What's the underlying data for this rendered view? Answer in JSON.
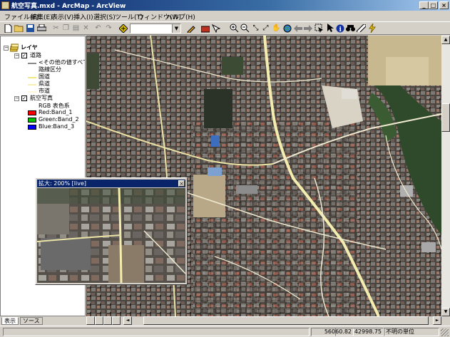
{
  "window": {
    "title": "航空写真.mxd - ArcMap - ArcView",
    "minimize_glyph": "_",
    "maximize_glyph": "□",
    "close_glyph": "×"
  },
  "menu": [
    "ファイル(F)",
    "編集(E)",
    "表示(V)",
    "挿入(I)",
    "選択(S)",
    "ツール(T)",
    "ウィンドウ(W)",
    "ヘルプ(H)"
  ],
  "toolbar": {
    "scale_value": "",
    "layer_value": "|0"
  },
  "toc": {
    "root_label": "レイヤ",
    "roads_layer": "道路",
    "roads_default_symbol": "<その他の値すべて>",
    "roads_field": "路線区分",
    "road_classes": [
      "国道",
      "県道",
      "市道"
    ],
    "photo_layer": "航空写真",
    "photo_renderer": "RGB 表色系",
    "bands": [
      "Red:Band_1",
      "Green:Band_2",
      "Blue:Band_3"
    ],
    "band_colors": [
      "#ff0000",
      "#00c000",
      "#0000ff"
    ],
    "road_class_colors": [
      "#f0e880",
      "#f8f0b0",
      "#fff8d8"
    ],
    "check_glyph": "✓",
    "collapse_glyph": "−"
  },
  "tabs": [
    "表示",
    "ソース"
  ],
  "magnifier": {
    "title": "拡大: 200% [live]",
    "close_glyph": "×"
  },
  "status": {
    "x": "56060.82",
    "y": "42998.75",
    "units": "不明の単位"
  },
  "scroll_glyphs": {
    "up": "▲",
    "down": "▼",
    "left": "◄",
    "right": "►"
  },
  "colors": {
    "titlebar": "#0a246a",
    "map_road": "#f3eeb0",
    "urban_base": "#4f4a45"
  }
}
